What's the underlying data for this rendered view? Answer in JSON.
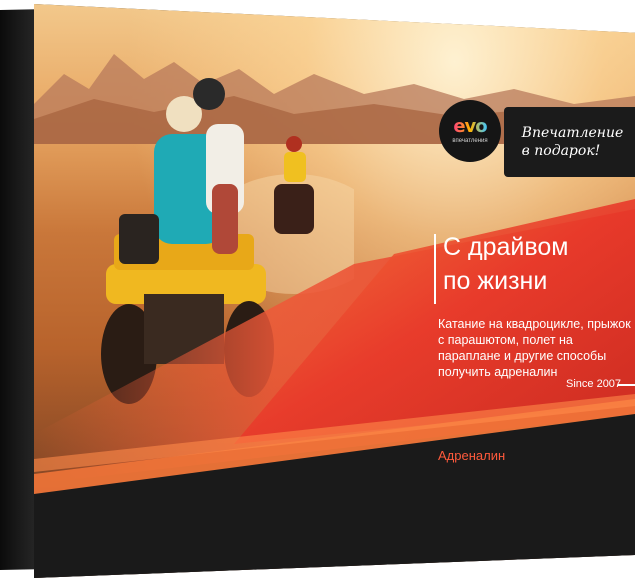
{
  "product": {
    "logo_name": "evo",
    "logo_subtitle": "впечатления",
    "badge_text": "Впечатление\nв подарок!",
    "headline": "С драйвом\nпо жизни",
    "description": "Катание на квадроцикле, прыжок с парашютом, полет на параплане и другие способы получить адреналин",
    "since": "Since 2007",
    "category": "Адреналин"
  },
  "colors": {
    "accent_red": "#e8392a",
    "accent_orange": "#f47a3a",
    "dark": "#1b1b1b"
  }
}
